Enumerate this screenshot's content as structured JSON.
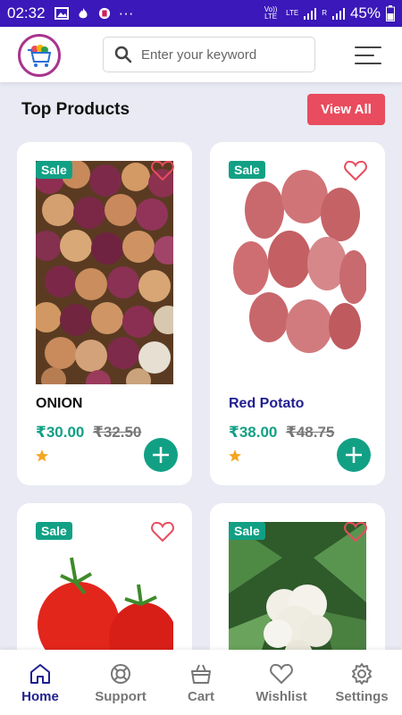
{
  "status_bar": {
    "time": "02:32",
    "battery": "45%",
    "dots": "···",
    "volte": "Vo)) LTE",
    "lte": "LTE",
    "r": "R"
  },
  "header": {
    "search_placeholder": "Enter your keyword"
  },
  "section": {
    "title": "Top Products",
    "view_all": "View All"
  },
  "products": [
    {
      "name": "ONION",
      "badge": "Sale",
      "price": "₹30.00",
      "old_price": "₹32.50",
      "name_color": "#111111"
    },
    {
      "name": "Red Potato",
      "badge": "Sale",
      "price": "₹38.00",
      "old_price": "₹48.75",
      "name_color": "#1f1f8f"
    },
    {
      "name": "",
      "badge": "Sale",
      "price": "",
      "old_price": ""
    },
    {
      "name": "",
      "badge": "Sale",
      "price": "",
      "old_price": ""
    }
  ],
  "bottom_nav": [
    {
      "label": "Home",
      "icon": "home-icon",
      "active": true
    },
    {
      "label": "Support",
      "icon": "support-icon"
    },
    {
      "label": "Cart",
      "icon": "cart-icon"
    },
    {
      "label": "Wishlist",
      "icon": "heart-icon"
    },
    {
      "label": "Settings",
      "icon": "gear-icon"
    }
  ],
  "colors": {
    "accent": "#12a085",
    "brand": "#3a18b9",
    "view_all": "#e84c5e"
  }
}
